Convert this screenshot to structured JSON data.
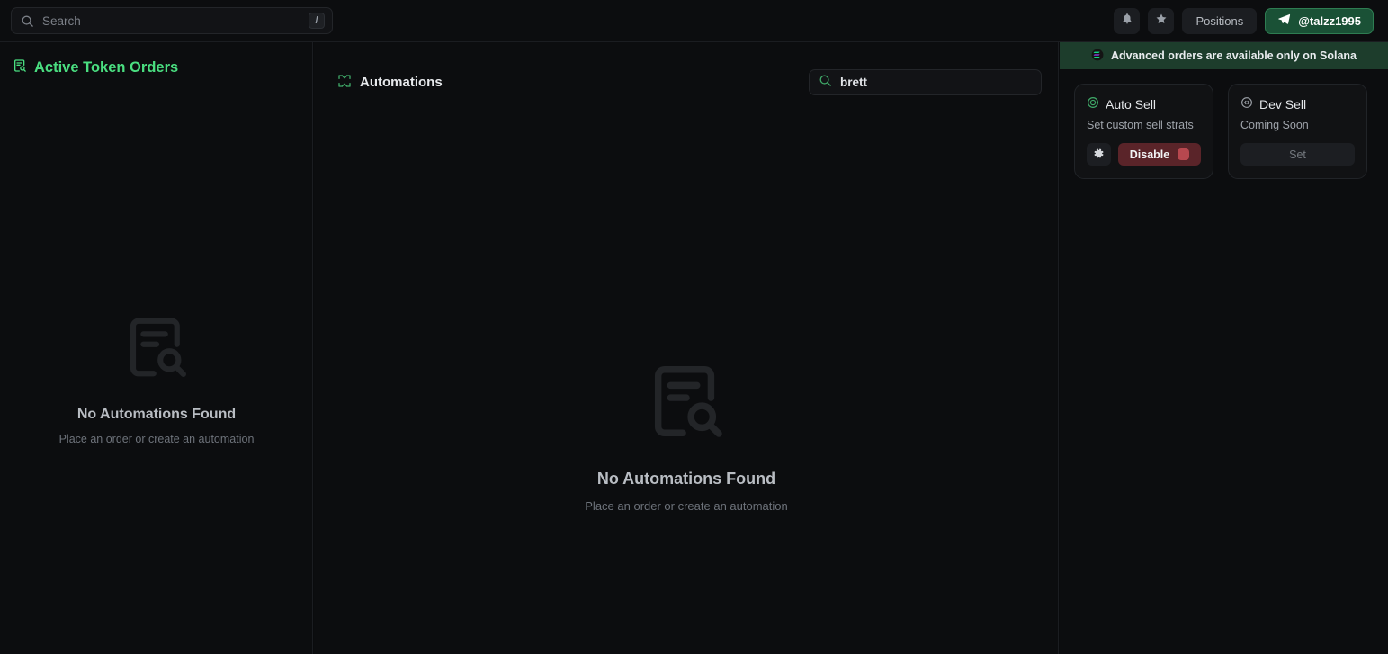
{
  "header": {
    "search": {
      "placeholder": "Search",
      "value": "",
      "shortcut": "/",
      "icon": "search-icon"
    },
    "notifications_icon": "bell-icon",
    "favorites_icon": "star-icon",
    "positions_label": "Positions",
    "account": {
      "handle": "@talzz1995",
      "icon": "telegram-icon"
    }
  },
  "left_panel": {
    "title": "Active Token Orders",
    "title_icon": "file-search-icon",
    "empty": {
      "icon": "file-search-icon",
      "title": "No Automations Found",
      "subtitle": "Place an order or create an automation"
    }
  },
  "center_panel": {
    "title": "Automations",
    "title_icon": "automation-loop-icon",
    "search": {
      "icon": "search-icon",
      "value": "brett",
      "placeholder": "Search"
    },
    "empty": {
      "icon": "file-search-icon",
      "title": "No Automations Found",
      "subtitle": "Place an order or create an automation"
    }
  },
  "right_panel": {
    "banner": {
      "icon": "solana-icon",
      "text": "Advanced orders are available only on Solana"
    },
    "cards": [
      {
        "icon": "target-circle-icon",
        "title": "Auto Sell",
        "subtitle": "Set custom sell strats",
        "settings_icon": "gear-icon",
        "action_label": "Disable",
        "state": "enabled"
      },
      {
        "icon": "code-circle-icon",
        "title": "Dev Sell",
        "subtitle": "Coming Soon",
        "action_label": "Set",
        "state": "disabled"
      }
    ]
  },
  "colors": {
    "accent_green": "#4ade80",
    "brand_green": "#1a5136",
    "danger_red": "#5a2429",
    "background": "#0a0b0d",
    "panel": "#0c0d0f"
  }
}
